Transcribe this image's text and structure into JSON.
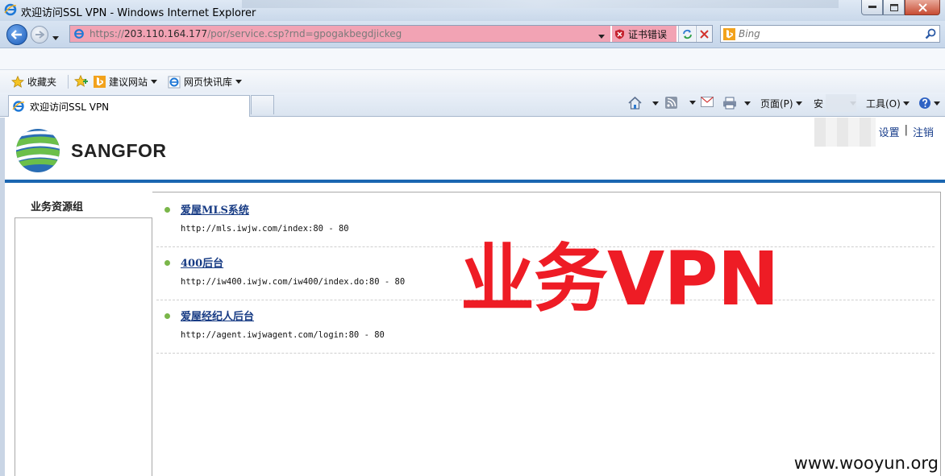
{
  "window": {
    "title": "欢迎访问SSL VPN - Windows Internet Explorer",
    "buttons": [
      "minimize",
      "maximize",
      "close"
    ]
  },
  "address_bar": {
    "scheme": "https://",
    "host": "203.110.164.177",
    "path": "/por/service.csp?rnd=gpogakbegdjickeg",
    "certificate_error": "证书错误"
  },
  "search": {
    "engine": "bing",
    "placeholder": "Bing"
  },
  "favorites_bar": {
    "favorites_label": "收藏夹",
    "suggested_sites": "建议网站",
    "web_slice_gallery": "网页快讯库"
  },
  "tab": {
    "label": "欢迎访问SSL VPN"
  },
  "command_bar": {
    "page": "页面(P)",
    "safety": "安",
    "tools": "工具(O)"
  },
  "header": {
    "brand": "SANGFOR",
    "settings": "设置",
    "separator": "|",
    "logout": "注销"
  },
  "sidebar": {
    "group": "业务资源组"
  },
  "resources": [
    {
      "name": "爱屋MLS系统",
      "address": "http://mls.iwjw.com/index:80 - 80"
    },
    {
      "name": "400后台",
      "address": "http://iw400.iwjw.com/iw400/index.do:80 - 80"
    },
    {
      "name": "爱屋经纪人后台",
      "address": "http://agent.iwjwagent.com/login:80 - 80"
    }
  ],
  "overlay": {
    "headline": "业务VPN",
    "watermark": "www.wooyun.org"
  },
  "colors": {
    "accent_blue": "#1b66b1",
    "link": "#173b84",
    "headline_red": "#ee1c25",
    "bullet_green": "#7ab64a",
    "cert_error_bg": "#f2a3b4"
  }
}
